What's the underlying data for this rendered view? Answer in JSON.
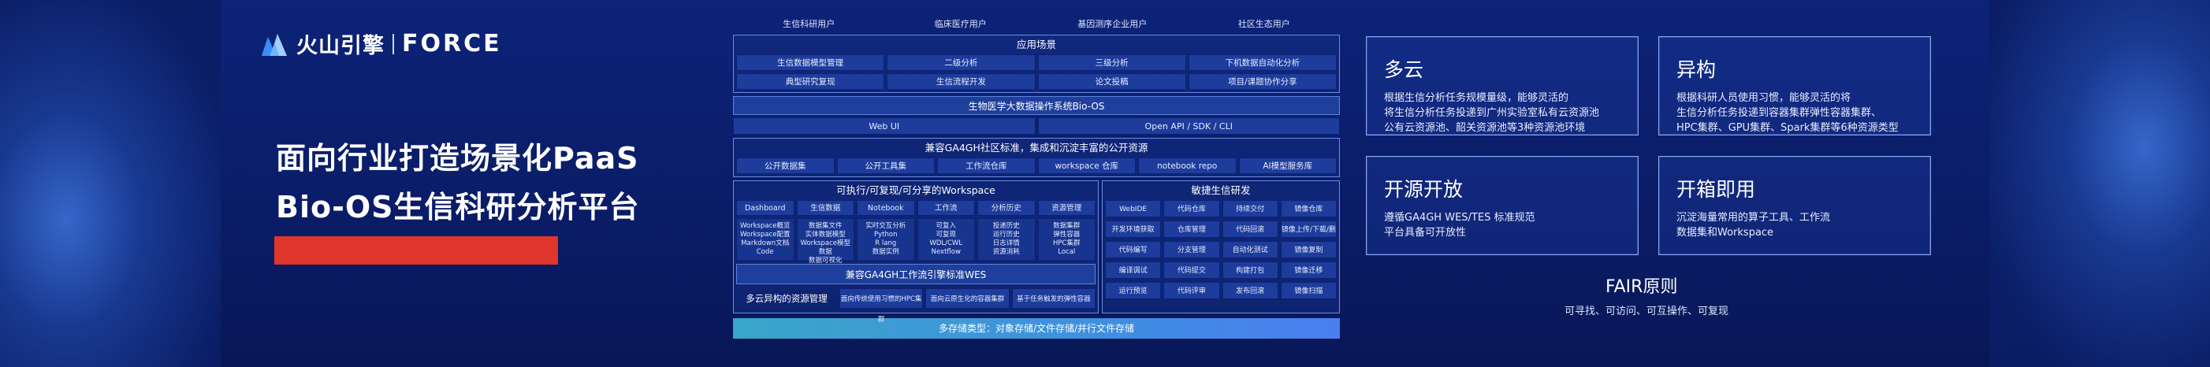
{
  "logo": {
    "cn": "火山引擎",
    "en": "FORCE"
  },
  "title": {
    "line1": "面向行业打造场景化PaaS",
    "line2": "Bio-OS生信科研分析平台"
  },
  "users": [
    "生信科研用户",
    "临床医疗用户",
    "基因测序企业用户",
    "社区生态用户"
  ],
  "app_scenes": {
    "title": "应用场景",
    "items": [
      "生信数据模型管理",
      "二级分析",
      "三级分析",
      "下机数据自动化分析",
      "典型研究复现",
      "生信流程开发",
      "论文投稿",
      "项目/课题协作分享"
    ]
  },
  "bio_os": {
    "title": "生物医学大数据操作系统Bio-OS",
    "interfaces": [
      "Web UI",
      "Open API / SDK / CLI"
    ]
  },
  "ga4gh_public": {
    "title": "兼容GA4GH社区标准，集成和沉淀丰富的公开资源",
    "items": [
      "公开数据集",
      "公开工具集",
      "工作流仓库",
      "workspace 仓库",
      "notebook repo",
      "AI模型服务库"
    ]
  },
  "workspace": {
    "title": "可执行/可复现/可分享的Workspace",
    "heads": [
      "Dashboard",
      "生信数据",
      "Notebook",
      "工作流",
      "分析历史"
    ],
    "bodies": [
      [
        "Workspace概览",
        "Workspace配置",
        "Markdown文档",
        "Code"
      ],
      [
        "数据集文件",
        "实体数据模型",
        "Workspace模型数据",
        "数据可视化"
      ],
      [
        "实时交互分析",
        "Python",
        "R lang",
        "数据实例"
      ],
      [
        "可复入",
        "可复现",
        "WDL/CWL",
        "Nextflow"
      ],
      [
        "投递历史",
        "运行历史",
        "日志详情",
        "资源消耗"
      ]
    ],
    "extra_head": "资源管理",
    "extra_body": [
      "数据集群",
      "弹性容器",
      "HPC集群",
      "Local"
    ],
    "wes": "兼容GA4GH工作流引擎标准WES",
    "multi_label": "多云异构的资源管理",
    "multi_items": [
      "面向传统使用习惯的HPC集群",
      "面向云原生化的容器集群",
      "基于任务触发的弹性容器"
    ]
  },
  "sensitive": {
    "title": "敏捷生信研发",
    "items": [
      "WebIDE",
      "代码仓库",
      "持续交付",
      "镜像仓库",
      "开发环境获取",
      "仓库管理",
      "代码回滚",
      "镜像上传/下载/删除",
      "代码编写",
      "分支管理",
      "自动化测试",
      "镜像复制",
      "编译调试",
      "代码提交",
      "构建打包",
      "镜像迁移",
      "运行预览",
      "代码评审",
      "发布回滚",
      "镜像扫描"
    ]
  },
  "storage": "多存储类型：对象存储/文件存储/并行文件存储",
  "cards": [
    {
      "title": "多云",
      "text": [
        "根据生信分析任务规模量级，能够灵活的",
        "将生信分析任务投递到广州实验室私有云资源池",
        "公有云资源池、韶关资源池等3种资源池环境"
      ]
    },
    {
      "title": "异构",
      "text": [
        "根据科研人员使用习惯，能够灵活的将",
        "生信分析任务投递到容器集群弹性容器集群、",
        "HPC集群、GPU集群、Spark集群等6种资源类型"
      ]
    },
    {
      "title": "开源开放",
      "text": [
        "遵循GA4GH WES/TES 标准规范",
        "平台具备可开放性"
      ]
    },
    {
      "title": "开箱即用",
      "text": [
        "沉淀海量常用的算子工具、工作流",
        "数据集和Workspace"
      ]
    }
  ],
  "fair": {
    "title": "FAIR原则",
    "subtitle": "可寻找、可访问、可互操作、可复现"
  }
}
